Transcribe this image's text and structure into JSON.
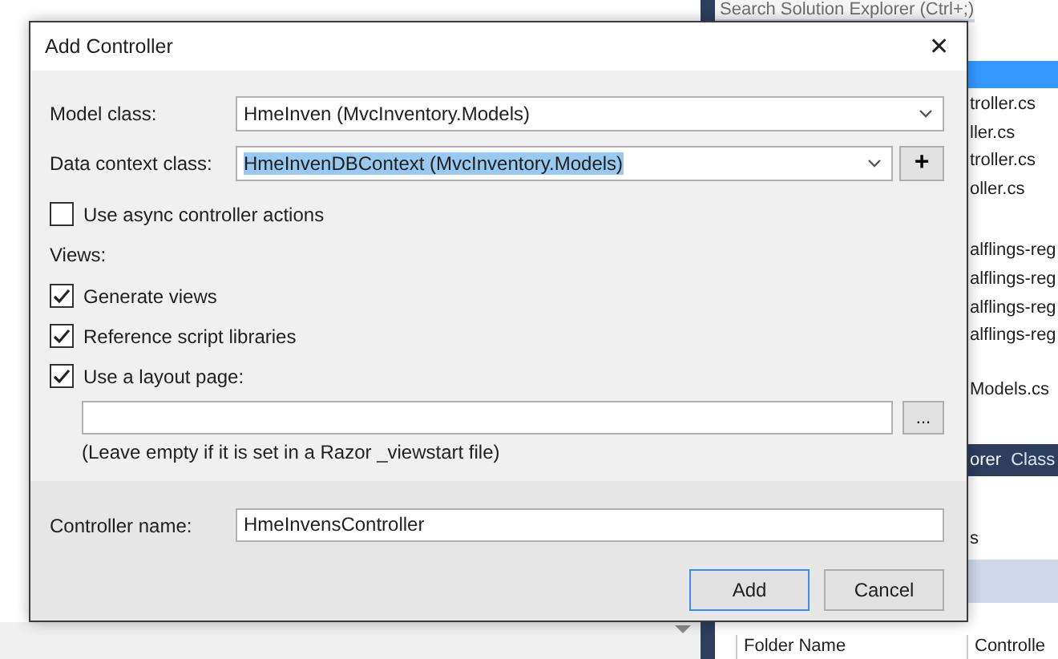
{
  "solution_explorer": {
    "search": {
      "placeholder": "Search Solution Explorer (Ctrl+;)"
    },
    "files": [
      {
        "name": "troller.cs"
      },
      {
        "name": "ller.cs"
      },
      {
        "name": "troller.cs"
      },
      {
        "name": "oller.cs"
      },
      {
        "name": "alflings-reg"
      },
      {
        "name": "alflings-reg"
      },
      {
        "name": "alflings-reg"
      },
      {
        "name": "alflings-reg"
      },
      {
        "name": "Models.cs"
      }
    ],
    "tabs": [
      {
        "label": "orer",
        "selected": true
      },
      {
        "label": "Class",
        "selected": false
      }
    ],
    "properties_text": "s",
    "table": {
      "columns": [
        "Folder Name",
        "Controlle"
      ]
    }
  },
  "dialog": {
    "title": "Add Controller",
    "close": "✕",
    "model_class": {
      "label": "Model class:",
      "value": "HmeInven (MvcInventory.Models)"
    },
    "data_context_class": {
      "label": "Data context class:",
      "value": "HmeInvenDBContext (MvcInventory.Models)",
      "text_selected": true,
      "add_button": "+"
    },
    "options": [
      {
        "label": "Use async controller actions",
        "checked": false
      }
    ],
    "views_label": "Views:",
    "view_options": [
      {
        "label": "Generate views",
        "checked": true
      },
      {
        "label": "Reference script libraries",
        "checked": true
      },
      {
        "label": "Use a layout page:",
        "checked": true
      }
    ],
    "layout_page": {
      "browse_button": "..."
    },
    "layout_note": "(Leave empty if it is set in a Razor _viewstart file)",
    "controller_name": {
      "label": "Controller name:",
      "value": "HmeInvensController"
    },
    "buttons": [
      {
        "label": "Add",
        "default": true
      },
      {
        "label": "Cancel",
        "default": false
      }
    ]
  }
}
